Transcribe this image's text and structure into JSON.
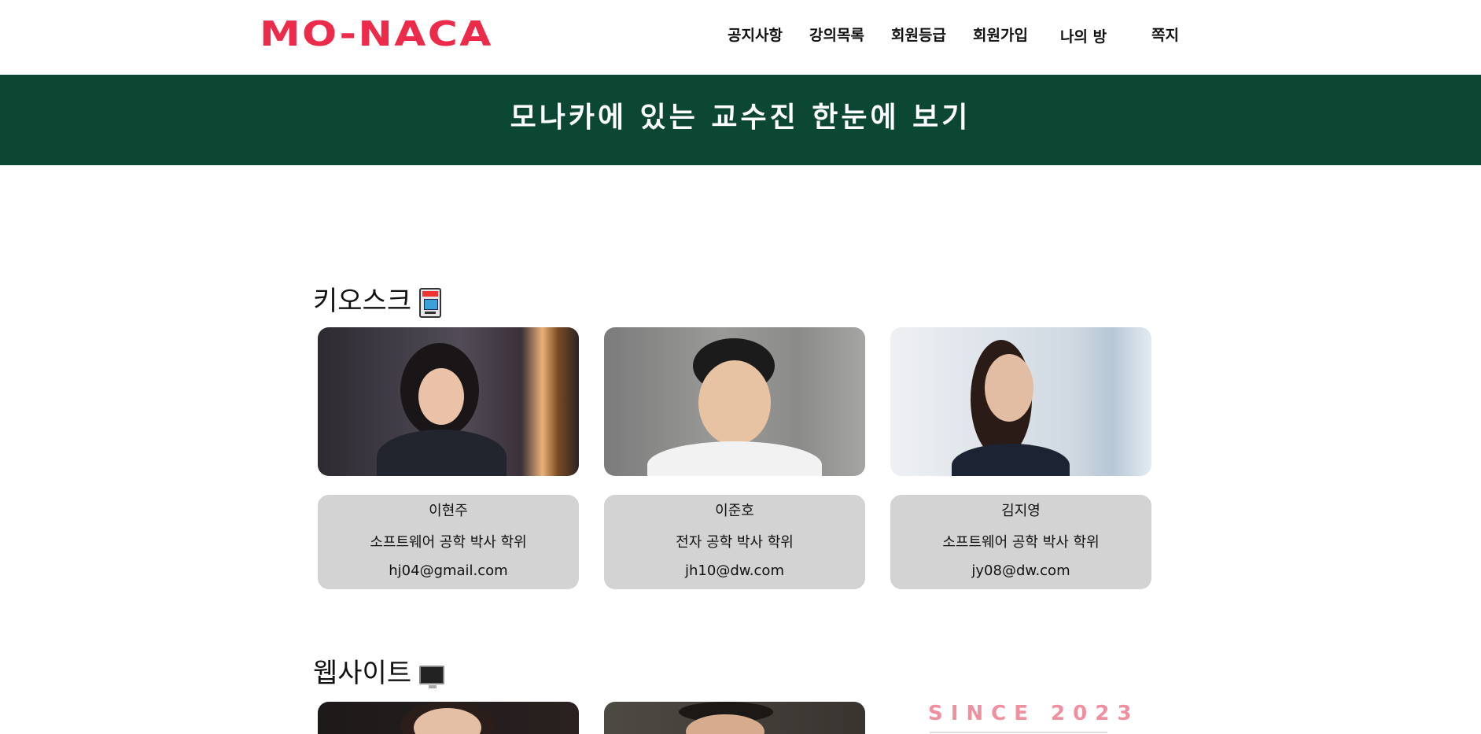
{
  "header": {
    "logo": "MO-NACA",
    "nav": [
      "공지사항",
      "강의목록",
      "회원등급",
      "회원가입",
      "나의 방",
      "쪽지"
    ]
  },
  "banner": {
    "title": "모나카에 있는 교수진 한눈에 보기"
  },
  "sections": [
    {
      "title": "키오스크",
      "icon": "atm-icon",
      "professors": [
        {
          "name": "이현주",
          "degree": "소프트웨어 공학 박사 학위",
          "email": "hj04@gmail.com"
        },
        {
          "name": "이준호",
          "degree": "전자 공학 박사 학위",
          "email": "jh10@dw.com"
        },
        {
          "name": "김지영",
          "degree": "소프트웨어 공학 박사 학위",
          "email": "jy08@dw.com"
        }
      ]
    },
    {
      "title": "웹사이트",
      "icon": "desktop-computer-icon"
    }
  ],
  "since": "SINCE 2023",
  "colors": {
    "logo": "#ec2a4a",
    "banner": "#0c4734",
    "card": "#d3d3d3",
    "since": "#ef8fa0"
  }
}
